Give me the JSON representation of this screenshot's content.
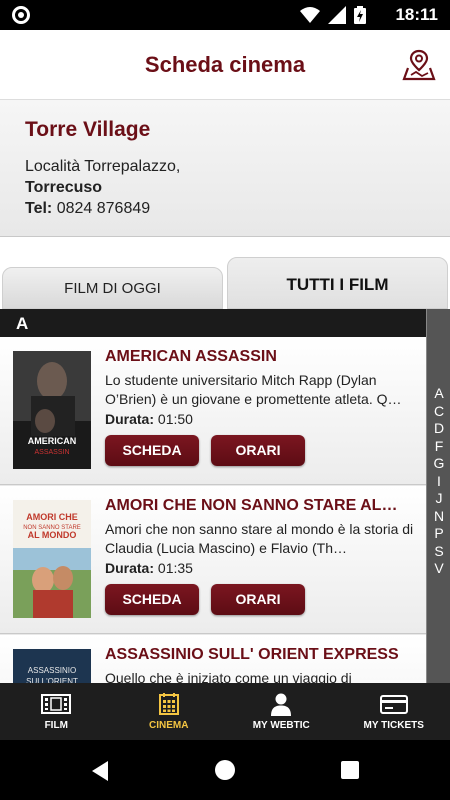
{
  "status": {
    "time": "18:11"
  },
  "header": {
    "title": "Scheda cinema",
    "map_icon": "map-pin-icon"
  },
  "cinema": {
    "name": "Torre Village",
    "address_line1": "Località Torrepalazzo,",
    "address_city": "Torrecuso",
    "tel_label": "Tel:",
    "tel_value": "0824 876849"
  },
  "tabs": [
    {
      "label": "FILM DI OGGI",
      "active": false
    },
    {
      "label": "TUTTI I FILM",
      "active": true
    }
  ],
  "section_letter": "A",
  "films": [
    {
      "title": "AMERICAN ASSASSIN",
      "description": "Lo studente universitario Mitch Rapp (Dylan O’Brien) è un giovane e promettente atleta. Q…",
      "duration_label": "Durata:",
      "duration_value": "01:50",
      "poster_text": "AMERICAN ASSASSIN",
      "scheda_label": "SCHEDA",
      "orari_label": "ORARI"
    },
    {
      "title": "AMORI CHE NON SANNO STARE AL…",
      "description": "Amori che non sanno stare al mondo è la storia di Claudia (Lucia Mascino) e Flavio (Th…",
      "duration_label": "Durata:",
      "duration_value": "01:35",
      "poster_text": "AMORI CHE NON SANNO STARE AL MONDO",
      "scheda_label": "SCHEDA",
      "orari_label": "ORARI"
    },
    {
      "title": "ASSASSINIO SULL' ORIENT EXPRESS",
      "description": "Quello che è iniziato come un viaggio di",
      "poster_text": "ASSASSINIO SULL'ORIENT"
    }
  ],
  "index_letters": [
    "A",
    "C",
    "D",
    "F",
    "G",
    "I",
    "J",
    "N",
    "P",
    "S",
    "V"
  ],
  "bottom_nav": [
    {
      "label": "FILM",
      "icon": "film-strip-icon",
      "active": false
    },
    {
      "label": "CINEMA",
      "icon": "calendar-grid-icon",
      "active": true
    },
    {
      "label": "MY WEBTIC",
      "icon": "user-icon",
      "active": false
    },
    {
      "label": "MY TICKETS",
      "icon": "credit-card-icon",
      "active": false
    }
  ],
  "colors": {
    "brand": "#6b0f17",
    "active_nav": "#f4c542"
  }
}
